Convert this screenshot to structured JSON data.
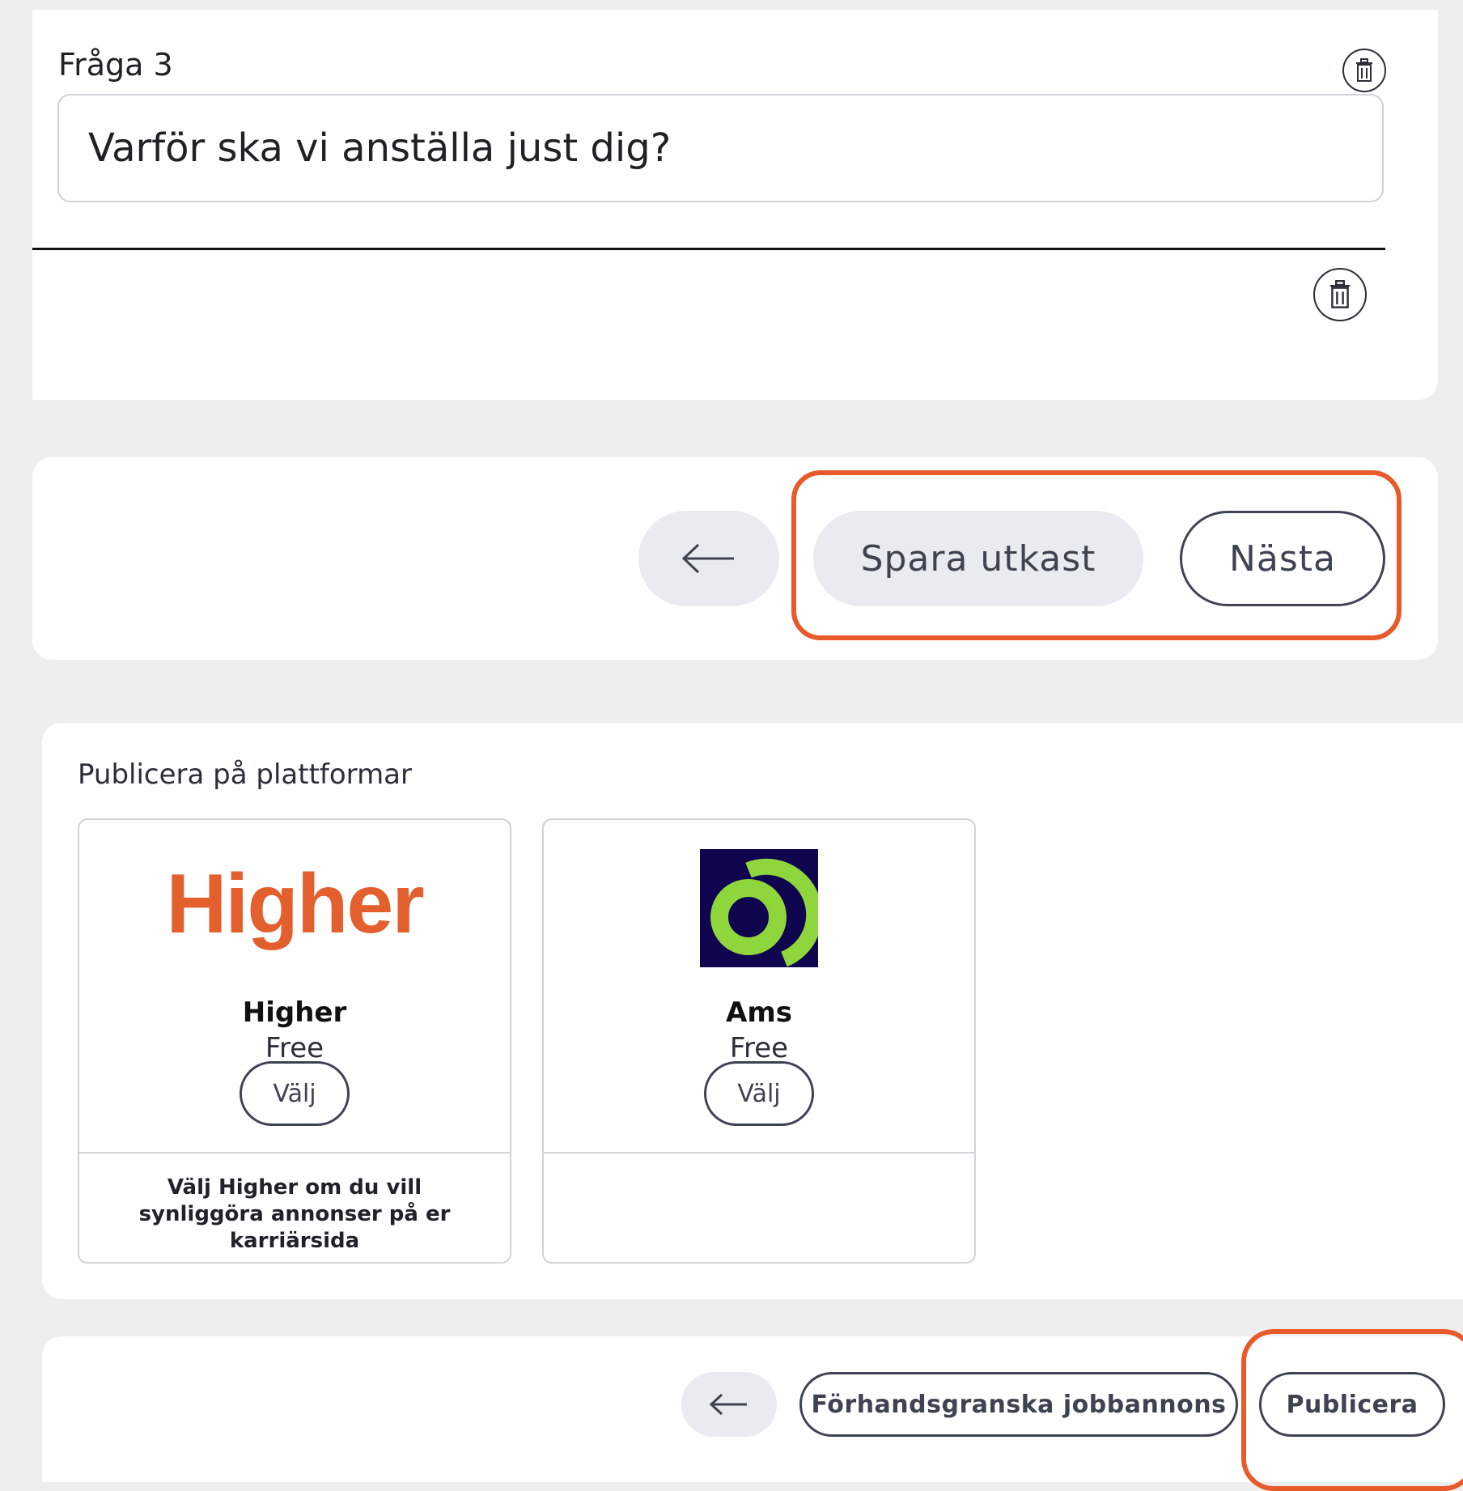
{
  "question": {
    "label": "Fråga 3",
    "value": "Varför ska vi anställa just dig?"
  },
  "navigation_top": {
    "back_icon": "arrow-left-icon",
    "save_draft_label": "Spara utkast",
    "next_label": "Nästa"
  },
  "platforms": {
    "title": "Publicera på plattformar",
    "items": [
      {
        "logo_text": "Higher",
        "name": "Higher",
        "price": "Free",
        "select_label": "Välj",
        "description": "Välj Higher om du vill synliggöra annonser på er karriärsida"
      },
      {
        "logo_icon": "ams-logo-icon",
        "name": "Ams",
        "price": "Free",
        "select_label": "Välj",
        "description": ""
      }
    ]
  },
  "navigation_bottom": {
    "back_icon": "arrow-left-icon",
    "preview_label": "Förhandsgranska jobbannons",
    "publish_label": "Publicera"
  },
  "colors": {
    "highlight": "#e85a2a",
    "higher_brand": "#e35f2d",
    "ams_bg": "#10054f",
    "ams_green": "#8fd63c"
  }
}
